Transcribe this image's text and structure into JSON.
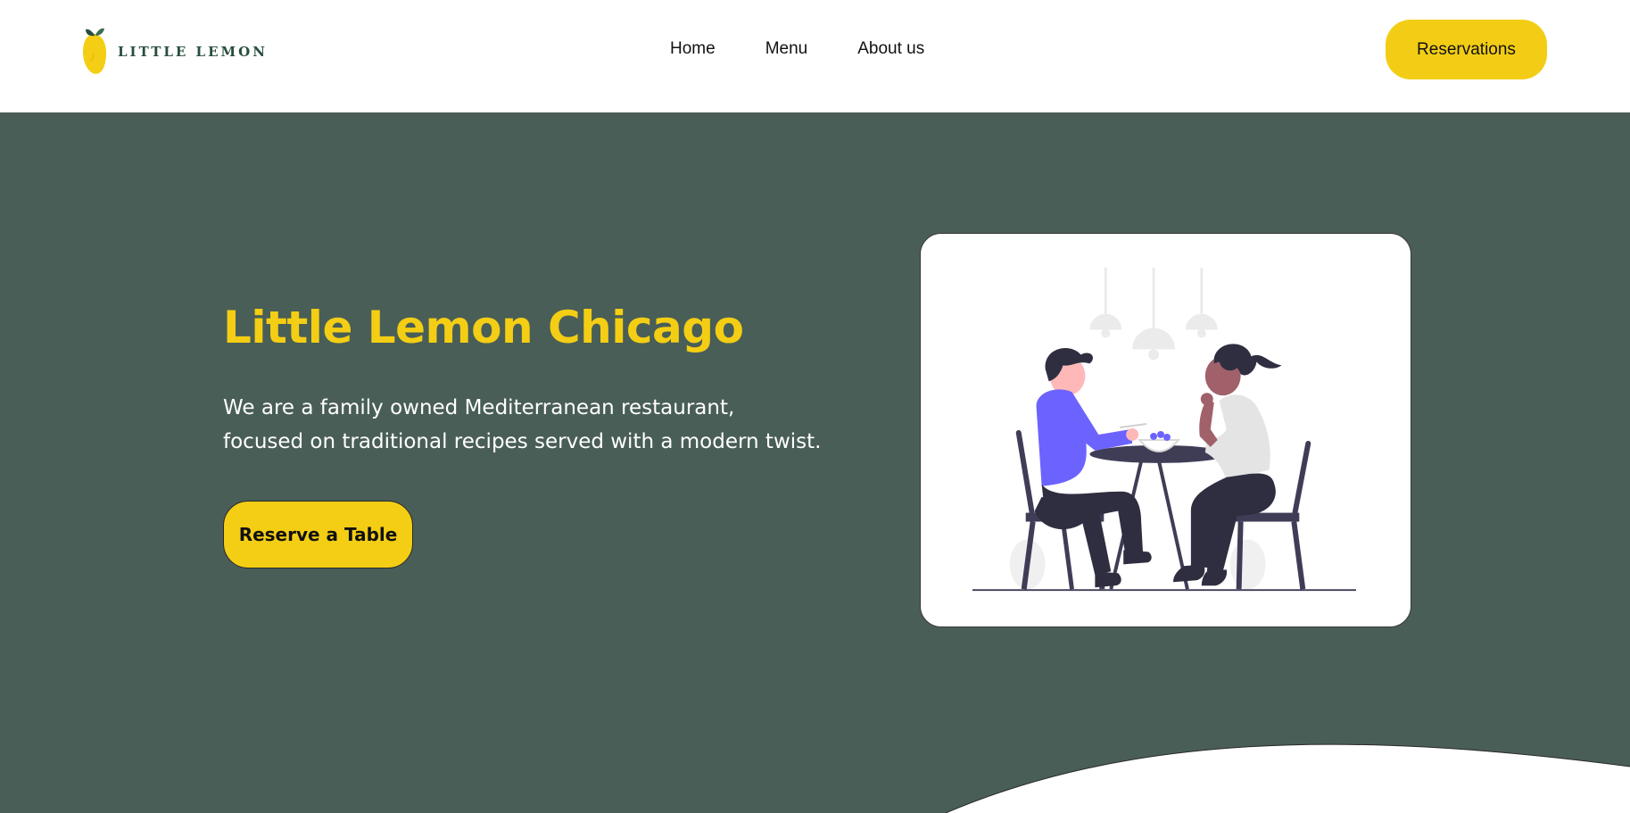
{
  "brand": {
    "name": "LITTLE LEMON",
    "logo_icon": "lemon-icon"
  },
  "nav": {
    "items": [
      {
        "label": "Home"
      },
      {
        "label": "Menu"
      },
      {
        "label": "About us"
      }
    ],
    "cta_label": "Reservations"
  },
  "hero": {
    "title": "Little Lemon Chicago",
    "description_lines": [
      "We are a family owned Mediterranean restaurant,",
      "focused on traditional recipes served with a modern twist."
    ],
    "cta_label": "Reserve a Table",
    "illustration": "dining-couple-illustration"
  },
  "colors": {
    "primary_green": "#495e57",
    "primary_yellow": "#f4ce14",
    "white": "#ffffff",
    "text_dark": "#111111",
    "logo_green": "#274e3d"
  }
}
